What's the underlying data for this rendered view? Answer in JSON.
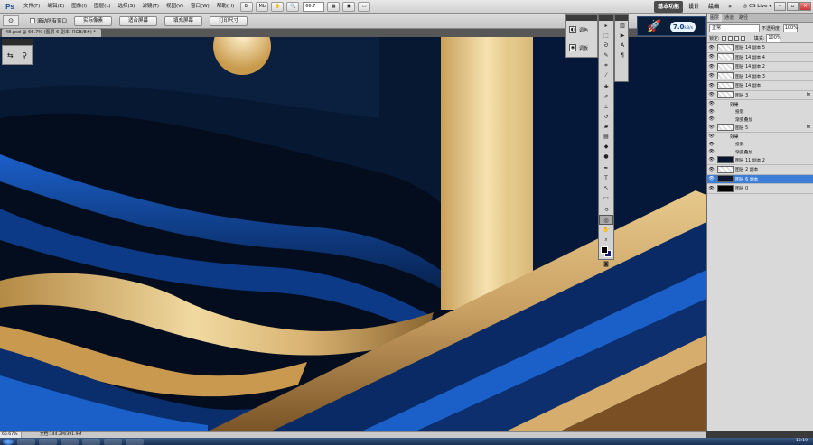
{
  "app": {
    "logo": "Ps"
  },
  "menu": [
    "文件(F)",
    "编辑(E)",
    "图像(I)",
    "图层(L)",
    "选择(S)",
    "滤镜(T)",
    "视图(V)",
    "窗口(W)",
    "帮助(H)"
  ],
  "toolbar": {
    "zoom_value": "66.7",
    "icons": [
      "bridge-icon",
      "minibridge-icon",
      "hand-icon",
      "zoom-icon",
      "grid-icon",
      "arrange-icon",
      "screen-mode-icon"
    ]
  },
  "workspace": {
    "items": [
      "基本功能",
      "设计",
      "绘画"
    ],
    "active": "基本功能",
    "more": "»",
    "cs_live": "CS Live"
  },
  "options": {
    "tool_icon": "zoom-tool-icon",
    "checkbox_label": "滚动所有窗口",
    "buttons": [
      "实际像素",
      "适合屏幕",
      "填充屏幕",
      "打印尺寸"
    ]
  },
  "document": {
    "tab_title": "48.psd @ 66.7% (图层 6 副本, RGB/8#) *",
    "zoom_status": "66.67%",
    "doc_info": "文档:144.2M/391.9M"
  },
  "adjustments": {
    "items": [
      {
        "icon": "adjustments-icon",
        "label": "调色"
      },
      {
        "icon": "masks-icon",
        "label": "调板"
      }
    ]
  },
  "network": {
    "value": "7.0",
    "unit": "kB/s"
  },
  "layers_panel": {
    "tabs": [
      "图层",
      "通道",
      "路径"
    ],
    "blend_mode": "正常",
    "opacity_label": "不透明度:",
    "opacity": "100%",
    "lock_label": "锁定:",
    "fill_label": "填充:",
    "fill": "100%",
    "layers": [
      {
        "name": "图层 14 副本 5",
        "type": "layer",
        "fx": false,
        "thumb": "light"
      },
      {
        "name": "图层 14 副本 4",
        "type": "layer",
        "fx": false,
        "thumb": "light"
      },
      {
        "name": "图层 14 副本 2",
        "type": "layer",
        "fx": false,
        "thumb": "light"
      },
      {
        "name": "图层 14 副本 3",
        "type": "layer",
        "fx": false,
        "thumb": "light"
      },
      {
        "name": "图层 14 副本",
        "type": "layer",
        "fx": false,
        "thumb": "light"
      },
      {
        "name": "图层 3",
        "type": "layer",
        "fx": true,
        "thumb": "light"
      },
      {
        "name": "效果",
        "type": "sub",
        "fx": false
      },
      {
        "name": "投影",
        "type": "sub2",
        "fx": false
      },
      {
        "name": "渐变叠加",
        "type": "sub2",
        "fx": false
      },
      {
        "name": "图层 5",
        "type": "layer",
        "fx": true,
        "thumb": "light"
      },
      {
        "name": "效果",
        "type": "sub",
        "fx": false
      },
      {
        "name": "投影",
        "type": "sub2",
        "fx": false
      },
      {
        "name": "渐变叠加",
        "type": "sub2",
        "fx": false
      },
      {
        "name": "图层 11 副本 2",
        "type": "layer",
        "fx": false,
        "thumb": "dark"
      },
      {
        "name": "图层 2 副本",
        "type": "layer",
        "fx": false,
        "thumb": "light"
      },
      {
        "name": "图层 6 副本",
        "type": "layer",
        "fx": false,
        "thumb": "dark",
        "selected": true
      },
      {
        "name": "图层 0",
        "type": "layer",
        "fx": false,
        "thumb": "black"
      }
    ]
  },
  "tools": [
    "move-tool-icon",
    "marquee-tool-icon",
    "lasso-tool-icon",
    "quick-select-tool-icon",
    "crop-tool-icon",
    "eyedropper-tool-icon",
    "healing-tool-icon",
    "brush-tool-icon",
    "clone-stamp-tool-icon",
    "history-brush-tool-icon",
    "eraser-tool-icon",
    "gradient-tool-icon",
    "blur-tool-icon",
    "dodge-tool-icon",
    "pen-tool-icon",
    "type-tool-icon",
    "path-select-tool-icon",
    "shape-tool-icon",
    "3d-rotate-tool-icon",
    "3d-orbit-tool-icon",
    "hand-tool-icon",
    "zoom-tool-icon"
  ],
  "clock": "13:19"
}
